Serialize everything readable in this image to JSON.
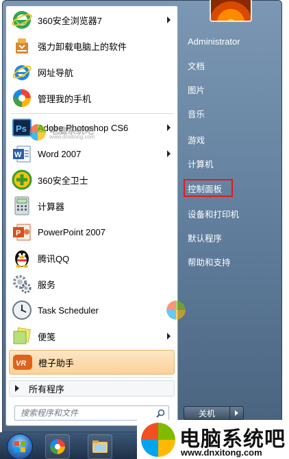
{
  "start_menu": {
    "programs": [
      {
        "label": "360安全浏览器7",
        "icon": "360-browser-icon",
        "submenu": true
      },
      {
        "label": "强力卸载电脑上的软件",
        "icon": "uninstall-icon",
        "submenu": false
      },
      {
        "label": "网址导航",
        "icon": "ie-navigation-icon",
        "submenu": false
      },
      {
        "label": "管理我的手机",
        "icon": "phone-manager-icon",
        "submenu": false
      },
      {
        "label": "Adobe Photoshop CS6",
        "icon": "photoshop-icon",
        "submenu": true
      },
      {
        "label": "Word 2007",
        "icon": "word-icon",
        "submenu": true
      },
      {
        "label": "360安全卫士",
        "icon": "360-safe-icon",
        "submenu": false
      },
      {
        "label": "计算器",
        "icon": "calculator-icon",
        "submenu": false
      },
      {
        "label": "PowerPoint 2007",
        "icon": "powerpoint-icon",
        "submenu": false
      },
      {
        "label": "腾讯QQ",
        "icon": "qq-penguin-icon",
        "submenu": false
      },
      {
        "label": "服务",
        "icon": "services-gear-icon",
        "submenu": false
      },
      {
        "label": "Task Scheduler",
        "icon": "clock-icon",
        "submenu": false
      },
      {
        "label": "便笺",
        "icon": "sticky-notes-icon",
        "submenu": true
      },
      {
        "label": "橙子助手",
        "icon": "orange-assistant-icon",
        "submenu": false
      }
    ],
    "all_programs": "所有程序",
    "search_placeholder": "搜索程序和文件",
    "right_items": [
      {
        "label": "Administrator"
      },
      {
        "label": "文档"
      },
      {
        "label": "图片"
      },
      {
        "label": "音乐"
      },
      {
        "label": "游戏"
      },
      {
        "label": "计算机"
      },
      {
        "label": "控制面板"
      },
      {
        "label": "设备和打印机"
      },
      {
        "label": "默认程序"
      },
      {
        "label": "帮助和支持"
      }
    ],
    "shutdown_label": "关机"
  },
  "watermark": {
    "small_name": "电脑系统吧",
    "small_url": "www.dnxitong.com",
    "big_name": "电脑系统吧",
    "big_url": "www.dnxitong.com"
  },
  "colors": {
    "highlight_box": "#e11a1a",
    "selected_item": "#fbd29a"
  }
}
